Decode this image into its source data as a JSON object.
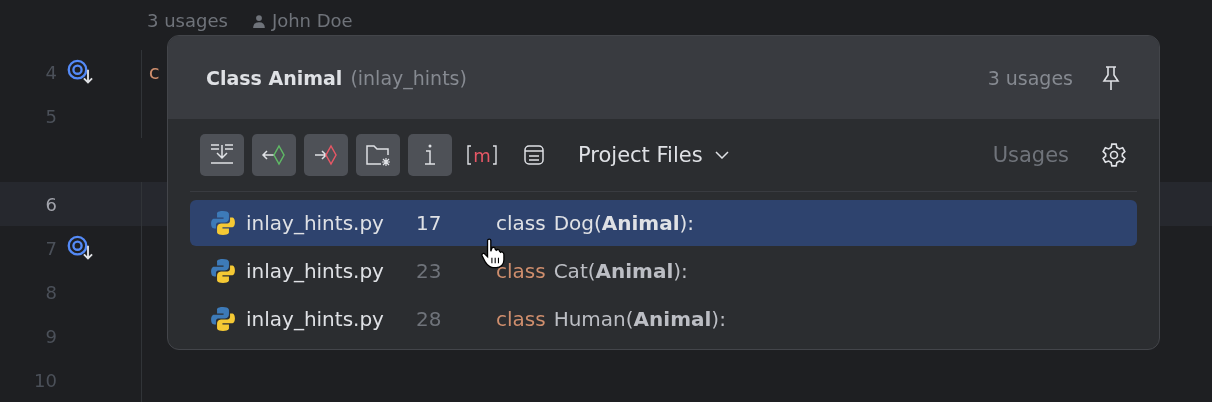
{
  "editor": {
    "inlay": {
      "usages": "3 usages",
      "author": "John Doe"
    },
    "lines": [
      {
        "number": "4",
        "current": false,
        "gutter_icon": true,
        "code": "c"
      },
      {
        "number": "5",
        "current": false,
        "gutter_icon": false
      },
      {
        "number": "6",
        "current": true,
        "gutter_icon": false
      },
      {
        "number": "7",
        "current": false,
        "gutter_icon": true
      },
      {
        "number": "8",
        "current": false,
        "gutter_icon": false
      },
      {
        "number": "9",
        "current": false,
        "gutter_icon": false
      },
      {
        "number": "10",
        "current": false,
        "gutter_icon": false
      }
    ]
  },
  "popup": {
    "title": "Class Animal",
    "context": "(inlay_hints)",
    "count": "3 usages",
    "toolbar": [
      {
        "kind": "merge",
        "selected": true
      },
      {
        "kind": "read",
        "selected": true
      },
      {
        "kind": "write",
        "selected": true
      },
      {
        "kind": "folder",
        "selected": true
      },
      {
        "kind": "info",
        "selected": true
      },
      {
        "kind": "method",
        "label": "m",
        "selected": false
      },
      {
        "kind": "preview",
        "selected": false
      }
    ],
    "scope": "Project Files",
    "usages_label": "Usages",
    "rows": [
      {
        "file": "inlay_hints.py",
        "line": "17",
        "keyword": "class",
        "code": "Dog(**Animal**):",
        "selected": true
      },
      {
        "file": "inlay_hints.py",
        "line": "23",
        "keyword": "class",
        "code": "Cat(**Animal**):",
        "selected": false
      },
      {
        "file": "inlay_hints.py",
        "line": "28",
        "keyword": "class",
        "code": "Human(**Animal**):",
        "selected": false
      }
    ]
  }
}
